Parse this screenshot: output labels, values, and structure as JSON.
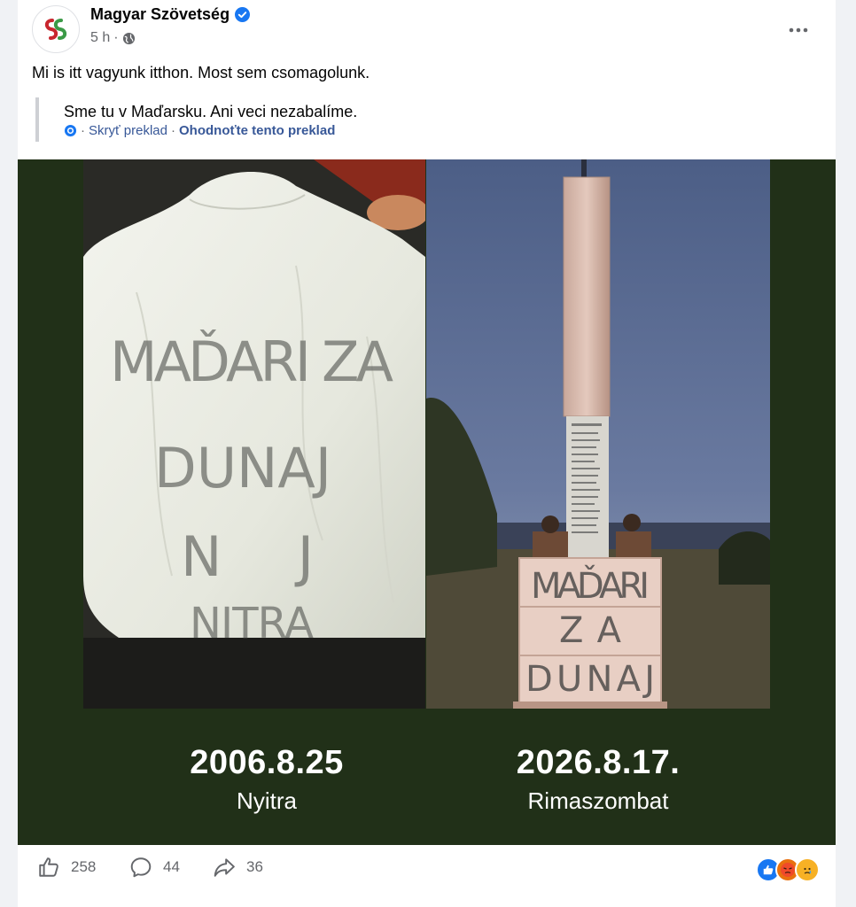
{
  "post": {
    "author": "Magyar Szövetség",
    "time": "5 h",
    "separator": "·",
    "text": "Mi is itt vagyunk itthon. Most sem csomagolunk.",
    "translation": {
      "text": "Sme tu v Maďarsku. Ani veci nezabalíme.",
      "sep1": "·",
      "hide": "Skryť preklad",
      "sep2": "·",
      "rate": "Ohodnoťte tento preklad"
    }
  },
  "media": {
    "left_photo": {
      "scribble_lines": [
        "MAĎARI ZA",
        "DUNAJ",
        "N J",
        "NITRA"
      ]
    },
    "right_photo": {
      "graffiti_lines": [
        "MAĎARI",
        "ZA",
        "DUNAJ"
      ]
    },
    "captions": [
      {
        "date": "2006.8.25",
        "place": "Nyitra"
      },
      {
        "date": "2026.8.17.",
        "place": "Rimaszombat"
      }
    ]
  },
  "actions": {
    "likes": "258",
    "comments": "44",
    "shares": "36"
  },
  "colors": {
    "media_bg": "#213018",
    "link_blue": "#385898",
    "verified_blue": "#1877f2"
  }
}
